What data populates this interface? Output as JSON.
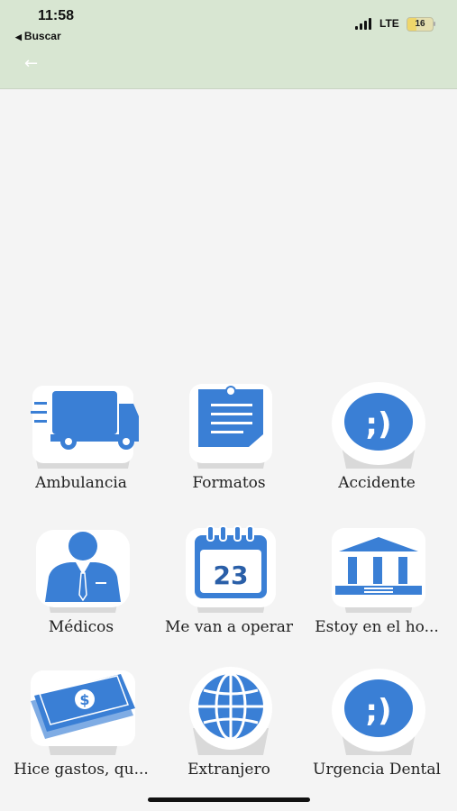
{
  "status_bar": {
    "time": "11:58",
    "back_app": "Buscar",
    "network": "LTE",
    "battery": "16"
  },
  "nav": {
    "back_icon": "arrow-left-icon"
  },
  "menu": [
    {
      "label": "Ambulancia",
      "icon": "truck-icon"
    },
    {
      "label": "Formatos",
      "icon": "note-icon"
    },
    {
      "label": "Accidente",
      "icon": "wink-icon"
    },
    {
      "label": "Médicos",
      "icon": "doctor-icon"
    },
    {
      "label": "Me van a operar",
      "icon": "calendar-icon"
    },
    {
      "label": "Estoy en el ho...",
      "icon": "building-icon"
    },
    {
      "label": "Hice gastos, qu...",
      "icon": "money-icon"
    },
    {
      "label": "Extranjero",
      "icon": "globe-icon"
    },
    {
      "label": "Urgencia Dental",
      "icon": "wink-icon"
    }
  ],
  "calendar_day": "23",
  "colors": {
    "accent": "#3a7fd5",
    "header": "#d8e6d2"
  }
}
